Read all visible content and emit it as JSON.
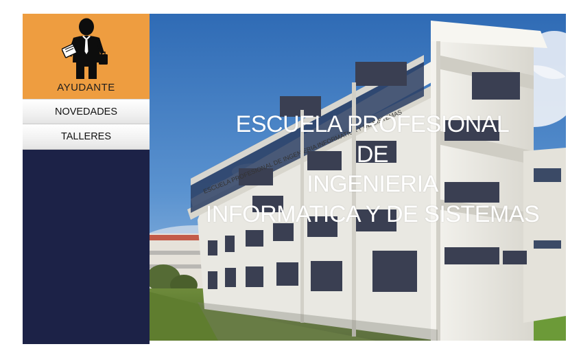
{
  "sidebar": {
    "role_label": "AYUDANTE",
    "avatar_icon": "businessman-with-clipboard-icon",
    "items": [
      {
        "label": "NOVEDADES"
      },
      {
        "label": "TALLERES"
      }
    ],
    "colors": {
      "card": "#ee9d40",
      "panel": "#1c2247"
    }
  },
  "hero": {
    "title_lines": [
      "ESCUELA PROFESIONAL",
      "DE",
      "INGENIERIA",
      "INFORMATICA Y DE SISTEMAS"
    ],
    "building_sign": "ESCUELA PROFESIONAL DE INGENIERIA INFORMATICA Y DE SISTEMAS"
  }
}
